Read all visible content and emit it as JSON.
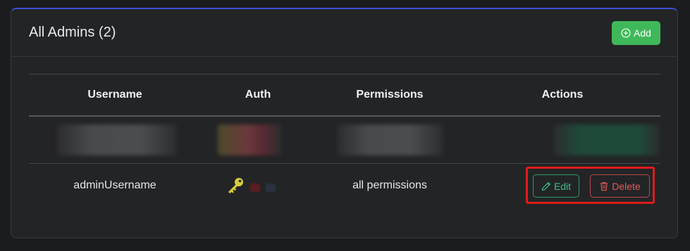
{
  "card": {
    "title": "All Admins (2)",
    "add_button": {
      "label": "Add",
      "icon": "plus-circle-icon"
    }
  },
  "table": {
    "columns": [
      "Username",
      "Auth",
      "Permissions",
      "Actions"
    ],
    "rows": [
      {
        "username": "adminUsername",
        "auth_icons": [
          "key-icon",
          "red-square-icon",
          "blue-square-icon"
        ],
        "permissions": "all permissions"
      }
    ],
    "actions": {
      "edit_label": "Edit",
      "delete_label": "Delete"
    }
  },
  "colors": {
    "accent_border": "#3d4fd6",
    "add_green": "#3fb85a",
    "edit_green": "#3fbf83",
    "delete_red": "#e25a5c",
    "highlight_red": "#e01b1b",
    "key_yellow": "#d9cc3a"
  }
}
